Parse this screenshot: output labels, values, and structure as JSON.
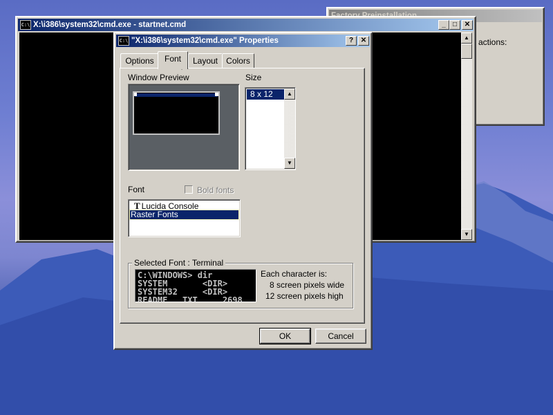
{
  "background_window": {
    "title": "Factory Preinstallation",
    "body_text": "actions:"
  },
  "cmd_window": {
    "title": "X:\\i386\\system32\\cmd.exe - startnet.cmd",
    "icon_text": "C:\\"
  },
  "dialog": {
    "title": "\"X:\\i386\\system32\\cmd.exe\" Properties",
    "icon_text": "C:\\",
    "help_button": "?",
    "close_button": "✕",
    "tabs": [
      {
        "label": "Options",
        "selected": false
      },
      {
        "label": "Font",
        "selected": true
      },
      {
        "label": "Layout",
        "selected": false
      },
      {
        "label": "Colors",
        "selected": false
      }
    ],
    "window_preview_label": "Window Preview",
    "size_label": "Size",
    "size_options": [
      "8 x 12"
    ],
    "size_selected": "8 x 12",
    "font_label": "Font",
    "bold_fonts_label": "Bold fonts",
    "bold_fonts_checked": false,
    "bold_fonts_enabled": false,
    "font_list": [
      {
        "label": "Lucida Console",
        "icon": "truetype-icon",
        "selected": false
      },
      {
        "label": "Raster Fonts",
        "icon": "",
        "selected": true
      }
    ],
    "selected_font_label": "Selected Font : Terminal",
    "sample_lines": [
      "C:\\WINDOWS> dir",
      "SYSTEM       <DIR>",
      "SYSTEM32     <DIR>",
      "README   TXT     2698"
    ],
    "char_info_title": "Each character is:",
    "char_width_text": "8 screen pixels wide",
    "char_height_text": "12 screen pixels high",
    "ok_label": "OK",
    "cancel_label": "Cancel"
  },
  "icons": {
    "minimize": "minimize-icon",
    "maximize": "maximize-icon",
    "close": "close-icon",
    "scroll_up": "scroll-up-icon",
    "scroll_down": "scroll-down-icon",
    "cursor": "mouse-pointer-icon"
  },
  "colors": {
    "active_title_start": "#0a246a",
    "active_title_end": "#a6caf0",
    "inactive_title_start": "#808080",
    "selection": "#0a246a",
    "console_bg": "#000000",
    "preview_bg": "#5a5f64"
  }
}
